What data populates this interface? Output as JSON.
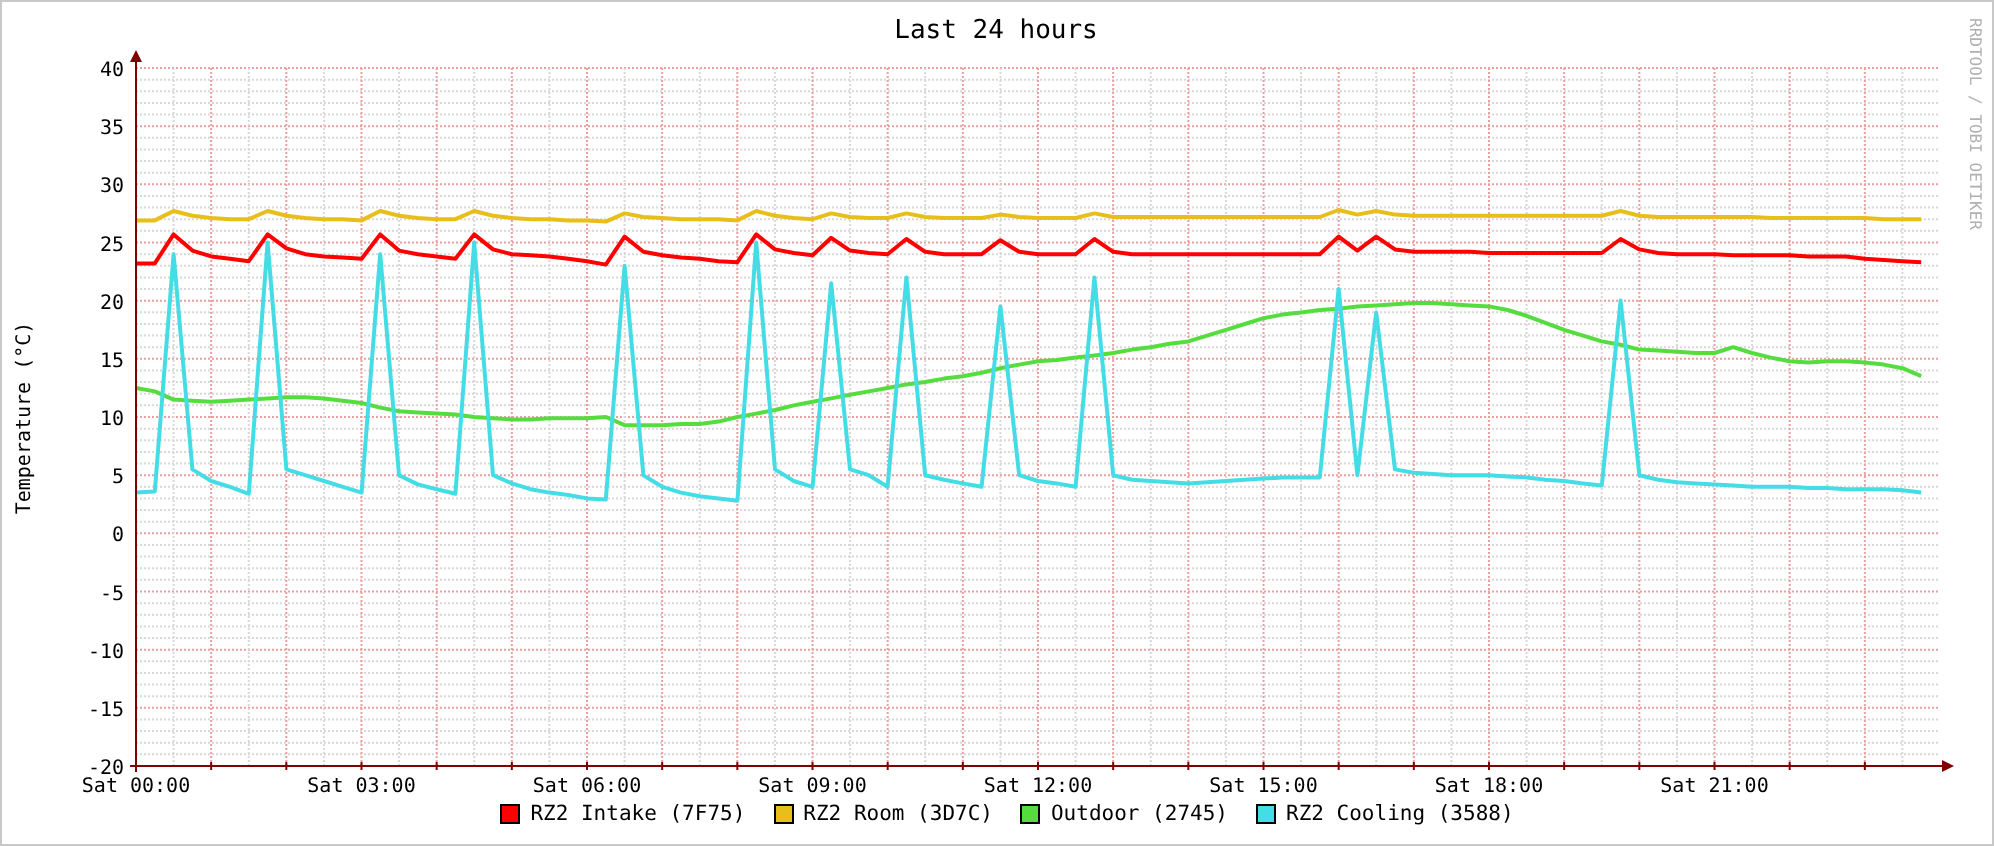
{
  "chart": {
    "credit": "RRDTOOL / TOBI OETIKER",
    "chart_data": {
      "type": "line",
      "title": "Last 24 hours",
      "ylabel": "Temperature (°C)",
      "categories": [
        "Sat 00:00",
        null,
        null,
        null,
        null,
        null,
        null,
        null,
        null,
        null,
        null,
        null,
        "Sat 03:00",
        null,
        null,
        null,
        null,
        null,
        null,
        null,
        null,
        null,
        null,
        null,
        "Sat 06:00",
        null,
        null,
        null,
        null,
        null,
        null,
        null,
        null,
        null,
        null,
        null,
        "Sat 09:00",
        null,
        null,
        null,
        null,
        null,
        null,
        null,
        null,
        null,
        null,
        null,
        "Sat 12:00",
        null,
        null,
        null,
        null,
        null,
        null,
        null,
        null,
        null,
        null,
        null,
        "Sat 15:00",
        null,
        null,
        null,
        null,
        null,
        null,
        null,
        null,
        null,
        null,
        null,
        "Sat 18:00",
        null,
        null,
        null,
        null,
        null,
        null,
        null,
        null,
        null,
        null,
        null,
        "Sat 21:00",
        null,
        null,
        null,
        null,
        null,
        null,
        null,
        null,
        null,
        null,
        null,
        null
      ],
      "series": [
        {
          "name": "RZ2 Intake (7F75)",
          "color": "#ff0000",
          "values": [
            23.2,
            23.2,
            25.7,
            24.3,
            23.8,
            23.6,
            23.4,
            25.7,
            24.5,
            24,
            23.8,
            23.7,
            23.6,
            25.7,
            24.3,
            24,
            23.8,
            23.6,
            25.7,
            24.4,
            24,
            23.9,
            23.8,
            23.6,
            23.4,
            23.1,
            25.5,
            24.2,
            23.9,
            23.7,
            23.6,
            23.4,
            23.3,
            25.7,
            24.4,
            24.1,
            23.9,
            25.4,
            24.3,
            24.1,
            24,
            25.3,
            24.2,
            24,
            24,
            24,
            25.2,
            24.2,
            24,
            24,
            24,
            25.3,
            24.2,
            24,
            24,
            24,
            24,
            24,
            24,
            24,
            24,
            24,
            24,
            24,
            25.5,
            24.3,
            25.5,
            24.4,
            24.2,
            24.2,
            24.2,
            24.2,
            24.1,
            24.1,
            24.1,
            24.1,
            24.1,
            24.1,
            24.1,
            25.3,
            24.4,
            24.1,
            24,
            24,
            24,
            23.9,
            23.9,
            23.9,
            23.9,
            23.8,
            23.8,
            23.8,
            23.6,
            23.5,
            23.4,
            23.3,
            null
          ]
        },
        {
          "name": "RZ2 Room (3D7C)",
          "color": "#e8bf1a",
          "values": [
            26.9,
            26.9,
            27.7,
            27.3,
            27.1,
            27,
            27,
            27.7,
            27.3,
            27.1,
            27,
            27,
            26.9,
            27.7,
            27.3,
            27.1,
            27,
            27,
            27.7,
            27.3,
            27.1,
            27,
            27,
            26.9,
            26.9,
            26.8,
            27.5,
            27.2,
            27.1,
            27,
            27,
            27,
            26.9,
            27.7,
            27.3,
            27.1,
            27,
            27.5,
            27.2,
            27.1,
            27.1,
            27.5,
            27.2,
            27.1,
            27.1,
            27.1,
            27.4,
            27.2,
            27.1,
            27.1,
            27.1,
            27.5,
            27.2,
            27.2,
            27.2,
            27.2,
            27.2,
            27.2,
            27.2,
            27.2,
            27.2,
            27.2,
            27.2,
            27.2,
            27.8,
            27.4,
            27.7,
            27.4,
            27.3,
            27.3,
            27.3,
            27.3,
            27.3,
            27.3,
            27.3,
            27.3,
            27.3,
            27.3,
            27.3,
            27.7,
            27.3,
            27.2,
            27.2,
            27.2,
            27.2,
            27.2,
            27.2,
            27.1,
            27.1,
            27.1,
            27.1,
            27.1,
            27.1,
            27,
            27,
            27,
            null
          ]
        },
        {
          "name": "Outdoor (2745)",
          "color": "#55dd3f",
          "values": [
            12.5,
            12.2,
            11.5,
            11.4,
            11.3,
            11.4,
            11.5,
            11.6,
            11.7,
            11.7,
            11.6,
            11.4,
            11.2,
            10.8,
            10.5,
            10.4,
            10.3,
            10.2,
            10,
            9.9,
            9.8,
            9.8,
            9.9,
            9.9,
            9.9,
            10,
            9.3,
            9.3,
            9.3,
            9.4,
            9.4,
            9.6,
            10,
            10.3,
            10.6,
            11,
            11.3,
            11.6,
            11.9,
            12.2,
            12.5,
            12.8,
            13,
            13.3,
            13.5,
            13.8,
            14.2,
            14.5,
            14.8,
            14.9,
            15.1,
            15.3,
            15.5,
            15.8,
            16,
            16.3,
            16.5,
            17,
            17.5,
            18,
            18.5,
            18.8,
            19,
            19.2,
            19.3,
            19.5,
            19.6,
            19.7,
            19.8,
            19.8,
            19.7,
            19.6,
            19.5,
            19.2,
            18.7,
            18.1,
            17.5,
            17,
            16.5,
            16.2,
            15.8,
            15.7,
            15.6,
            15.5,
            15.5,
            16,
            15.5,
            15.1,
            14.8,
            14.7,
            14.8,
            14.8,
            14.7,
            14.5,
            14.2,
            13.5,
            null
          ]
        },
        {
          "name": "RZ2 Cooling (3588)",
          "color": "#44dde6",
          "values": [
            3.5,
            3.6,
            24,
            5.5,
            4.5,
            4,
            3.4,
            25,
            5.5,
            5,
            4.5,
            4,
            3.5,
            24,
            5,
            4.2,
            3.8,
            3.4,
            25,
            5,
            4.3,
            3.8,
            3.5,
            3.3,
            3,
            2.9,
            23,
            5,
            4,
            3.5,
            3.2,
            3,
            2.8,
            25,
            5.5,
            4.5,
            4,
            21.5,
            5.5,
            5,
            4,
            22,
            5,
            4.6,
            4.3,
            4,
            19.5,
            5,
            4.5,
            4.3,
            4,
            22,
            5,
            4.6,
            4.5,
            4.4,
            4.3,
            4.4,
            4.5,
            4.6,
            4.7,
            4.8,
            4.8,
            4.8,
            21,
            5,
            19,
            5.5,
            5.2,
            5.1,
            5,
            5,
            5,
            4.9,
            4.8,
            4.6,
            4.5,
            4.3,
            4.1,
            20,
            5,
            4.6,
            4.4,
            4.3,
            4.2,
            4.1,
            4,
            4,
            4,
            3.9,
            3.9,
            3.8,
            3.8,
            3.8,
            3.7,
            3.5,
            null
          ]
        }
      ],
      "ylim": [
        -20,
        40
      ],
      "grid": true,
      "yticks": [
        -20,
        -15,
        -10,
        -5,
        0,
        5,
        10,
        15,
        20,
        25,
        30,
        35,
        40
      ]
    }
  }
}
